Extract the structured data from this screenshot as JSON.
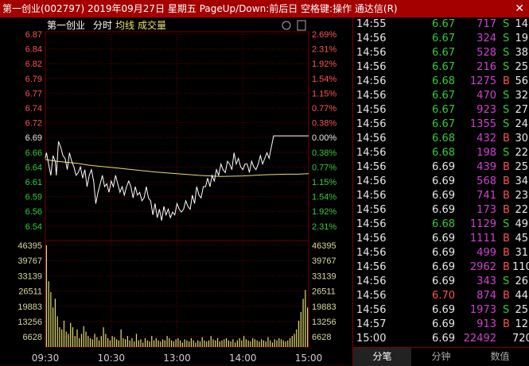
{
  "window": {
    "title": "第一创业(002797)  2019年09月27日 星期五  PageUp/Down:前后日  空格键:操作  通达信(R)",
    "close": "✕"
  },
  "chart_header": {
    "name": "第一创业",
    "period": "分时",
    "avg_label": "均线",
    "vol_label": "成交量"
  },
  "colors": {
    "up": "#ff5050",
    "down": "#33cc33",
    "neutral": "#e8e8e8",
    "volume_text": "#d040d0",
    "price_line": "#ffffff",
    "avg_line": "#e8e070",
    "volume_bars": "#e8e070",
    "vol_axis": "#d8d8a0",
    "grid": "#700000"
  },
  "chart_data": {
    "type": "line",
    "price_ticks": [
      "6.87",
      "6.84",
      "6.82",
      "6.79",
      "6.77",
      "6.74",
      "6.72",
      "6.69",
      "6.66",
      "6.64",
      "6.61",
      "6.59",
      "6.56",
      "6.54"
    ],
    "pct_ticks": [
      "2.69%",
      "2.31%",
      "1.92%",
      "1.54%",
      "1.15%",
      "0.77%",
      "0.38%",
      "0.00%",
      "0.38%",
      "0.77%",
      "1.15%",
      "1.54%",
      "1.92%",
      "2.31%"
    ],
    "prev_close": 6.69,
    "price_range": [
      6.52,
      6.87
    ],
    "vol_ticks": [
      "46395",
      "39767",
      "33139",
      "26511",
      "19883",
      "13256",
      "6628"
    ],
    "vol_max": 46395,
    "time_labels": [
      "09:30",
      "10:30",
      "13:00",
      "14:00",
      "15:00"
    ],
    "price_x": [
      0,
      1,
      3,
      5,
      7,
      9,
      10,
      12,
      14,
      16,
      18,
      20,
      22,
      24,
      26,
      28,
      30,
      32,
      34,
      36,
      38,
      40,
      42,
      44,
      46,
      48,
      50,
      52,
      54,
      56,
      58,
      60,
      62,
      64,
      66,
      68,
      70,
      72,
      74,
      76,
      78,
      80,
      82,
      84,
      86,
      88,
      90,
      92,
      94,
      96,
      98,
      100,
      102,
      104,
      106,
      108,
      110,
      112,
      114,
      116,
      118,
      120,
      122,
      124,
      126,
      128,
      130,
      132,
      134,
      136,
      138,
      140,
      142,
      144,
      146,
      148,
      150,
      152,
      154,
      156,
      158,
      160,
      162,
      164,
      166,
      168,
      170,
      172,
      174,
      176,
      178,
      180,
      182,
      184,
      186,
      188,
      190,
      192,
      194,
      196,
      198,
      200,
      202,
      204,
      206,
      208,
      210,
      212,
      214,
      216,
      218,
      220,
      222,
      224,
      226,
      228,
      230,
      232,
      234,
      236,
      238,
      240
    ],
    "price_y": [
      6.65,
      6.66,
      6.64,
      6.62,
      6.655,
      6.645,
      6.62,
      6.68,
      6.67,
      6.655,
      6.65,
      6.63,
      6.66,
      6.645,
      6.635,
      6.62,
      6.625,
      6.635,
      6.615,
      6.63,
      6.6,
      6.62,
      6.63,
      6.61,
      6.57,
      6.59,
      6.605,
      6.62,
      6.6,
      6.605,
      6.59,
      6.61,
      6.6,
      6.62,
      6.605,
      6.59,
      6.6,
      6.585,
      6.6,
      6.61,
      6.6,
      6.58,
      6.6,
      6.585,
      6.59,
      6.575,
      6.58,
      6.6,
      6.58,
      6.575,
      6.55,
      6.57,
      6.545,
      6.56,
      6.54,
      6.565,
      6.55,
      6.56,
      6.545,
      6.555,
      6.55,
      6.57,
      6.56,
      6.555,
      6.56,
      6.575,
      6.565,
      6.56,
      6.585,
      6.57,
      6.6,
      6.585,
      6.58,
      6.6,
      6.6,
      6.615,
      6.6,
      6.62,
      6.61,
      6.63,
      6.62,
      6.64,
      6.63,
      6.625,
      6.645,
      6.64,
      6.63,
      6.66,
      6.64,
      6.65,
      6.635,
      6.63,
      6.64,
      6.64,
      6.625,
      6.645,
      6.635,
      6.63,
      6.64,
      6.655,
      6.64,
      6.65,
      6.66,
      6.65,
      6.67,
      6.69,
      6.69,
      6.69,
      6.69,
      6.69,
      6.69,
      6.69,
      6.69,
      6.69,
      6.69,
      6.69,
      6.69,
      6.69,
      6.69,
      6.69,
      6.69,
      6.69
    ],
    "avg_x": [
      0,
      10,
      20,
      30,
      40,
      60,
      80,
      100,
      120,
      140,
      160,
      180,
      200,
      220,
      230,
      240
    ],
    "avg_y": [
      6.648,
      6.645,
      6.643,
      6.641,
      6.638,
      6.634,
      6.63,
      6.626,
      6.623,
      6.62,
      6.618,
      6.619,
      6.621,
      6.622,
      6.622,
      6.623
    ],
    "volume": [
      46395,
      30000,
      25000,
      18000,
      22000,
      14000,
      9000,
      8000,
      12000,
      7000,
      6000,
      11000,
      9000,
      5000,
      8000,
      4000,
      6000,
      9500,
      7000,
      5000,
      4000,
      3500,
      6000,
      4500,
      3000,
      5000,
      9000,
      6000,
      4000,
      3000,
      5000,
      4500,
      3500,
      3000,
      8000,
      4000,
      3500,
      5000,
      3000,
      4000,
      2500,
      6000,
      3000,
      3500,
      2000,
      4000,
      3000,
      2500,
      5000,
      3000,
      4000,
      3000,
      2500,
      3500,
      3000,
      5000,
      4000,
      3000,
      2500,
      3500,
      4000,
      3000,
      2000,
      3500,
      3000,
      2500,
      4000,
      3000,
      2000,
      3000,
      2500,
      4500,
      3000,
      2500,
      3000,
      5000,
      3500,
      3000,
      4000,
      2500,
      3000,
      3500,
      4000,
      3000,
      2500,
      3500,
      2000,
      3000,
      4000,
      3000,
      5000,
      3500,
      3000,
      2500,
      4000,
      3500,
      3000,
      2500,
      3500,
      3000,
      2500,
      4500,
      3000,
      2000,
      3500,
      3000,
      4000,
      3500,
      3000,
      2500,
      3000,
      4000,
      5000,
      6000,
      8000,
      12000,
      16000,
      22000,
      26000,
      18000
    ]
  },
  "ticks": [
    {
      "time": "14:55",
      "price": "6.67",
      "vol": "717",
      "bs": "S",
      "cnt": "14",
      "pc": "down",
      "bc": "down"
    },
    {
      "time": "14:56",
      "price": "6.67",
      "vol": "324",
      "bs": "S",
      "cnt": "19",
      "pc": "down",
      "bc": "down"
    },
    {
      "time": "14:56",
      "price": "6.67",
      "vol": "528",
      "bs": "S",
      "cnt": "38",
      "pc": "down",
      "bc": "down"
    },
    {
      "time": "14:56",
      "price": "6.67",
      "vol": "216",
      "bs": "S",
      "cnt": "25",
      "pc": "down",
      "bc": "down"
    },
    {
      "time": "14:56",
      "price": "6.68",
      "vol": "1275",
      "bs": "B",
      "cnt": "56",
      "pc": "down",
      "bc": "up"
    },
    {
      "time": "14:56",
      "price": "6.67",
      "vol": "470",
      "bs": "S",
      "cnt": "32",
      "pc": "down",
      "bc": "down"
    },
    {
      "time": "14:56",
      "price": "6.67",
      "vol": "923",
      "bs": "S",
      "cnt": "27",
      "pc": "down",
      "bc": "down"
    },
    {
      "time": "14:56",
      "price": "6.67",
      "vol": "1355",
      "bs": "S",
      "cnt": "24",
      "pc": "down",
      "bc": "down"
    },
    {
      "time": "14:56",
      "price": "6.68",
      "vol": "432",
      "bs": "B",
      "cnt": "30",
      "pc": "down",
      "bc": "up"
    },
    {
      "time": "14:56",
      "price": "6.68",
      "vol": "198",
      "bs": "S",
      "cnt": "22",
      "pc": "down",
      "bc": "down"
    },
    {
      "time": "14:56",
      "price": "6.69",
      "vol": "439",
      "bs": "B",
      "cnt": "25",
      "pc": "neutral",
      "bc": "up"
    },
    {
      "time": "14:56",
      "price": "6.69",
      "vol": "568",
      "bs": "B",
      "cnt": "34",
      "pc": "neutral",
      "bc": "up"
    },
    {
      "time": "14:56",
      "price": "6.69",
      "vol": "741",
      "bs": "B",
      "cnt": "23",
      "pc": "neutral",
      "bc": "up"
    },
    {
      "time": "14:56",
      "price": "6.69",
      "vol": "173",
      "bs": "B",
      "cnt": "22",
      "pc": "neutral",
      "bc": "up"
    },
    {
      "time": "14:56",
      "price": "6.68",
      "vol": "1129",
      "bs": "S",
      "cnt": "49",
      "pc": "down",
      "bc": "down"
    },
    {
      "time": "14:56",
      "price": "6.69",
      "vol": "1111",
      "bs": "B",
      "cnt": "45",
      "pc": "neutral",
      "bc": "up"
    },
    {
      "time": "14:56",
      "price": "6.69",
      "vol": "499",
      "bs": "B",
      "cnt": "31",
      "pc": "neutral",
      "bc": "up"
    },
    {
      "time": "14:56",
      "price": "6.69",
      "vol": "2962",
      "bs": "B",
      "cnt": "110",
      "pc": "neutral",
      "bc": "up"
    },
    {
      "time": "14:56",
      "price": "6.69",
      "vol": "343",
      "bs": "S",
      "cnt": "26",
      "pc": "neutral",
      "bc": "down"
    },
    {
      "time": "14:56",
      "price": "6.70",
      "vol": "874",
      "bs": "B",
      "cnt": "44",
      "pc": "up",
      "bc": "up"
    },
    {
      "time": "14:56",
      "price": "6.69",
      "vol": "1973",
      "bs": "S",
      "cnt": "25",
      "pc": "neutral",
      "bc": "down"
    },
    {
      "time": "14:57",
      "price": "6.69",
      "vol": "913",
      "bs": "B",
      "cnt": "12",
      "pc": "neutral",
      "bc": "up"
    },
    {
      "time": "15:00",
      "price": "6.69",
      "vol": "22492",
      "bs": "",
      "cnt": "720",
      "pc": "neutral",
      "bc": "up"
    }
  ],
  "tabs": [
    "分笔",
    "分钟",
    "数值"
  ],
  "active_tab": 0
}
